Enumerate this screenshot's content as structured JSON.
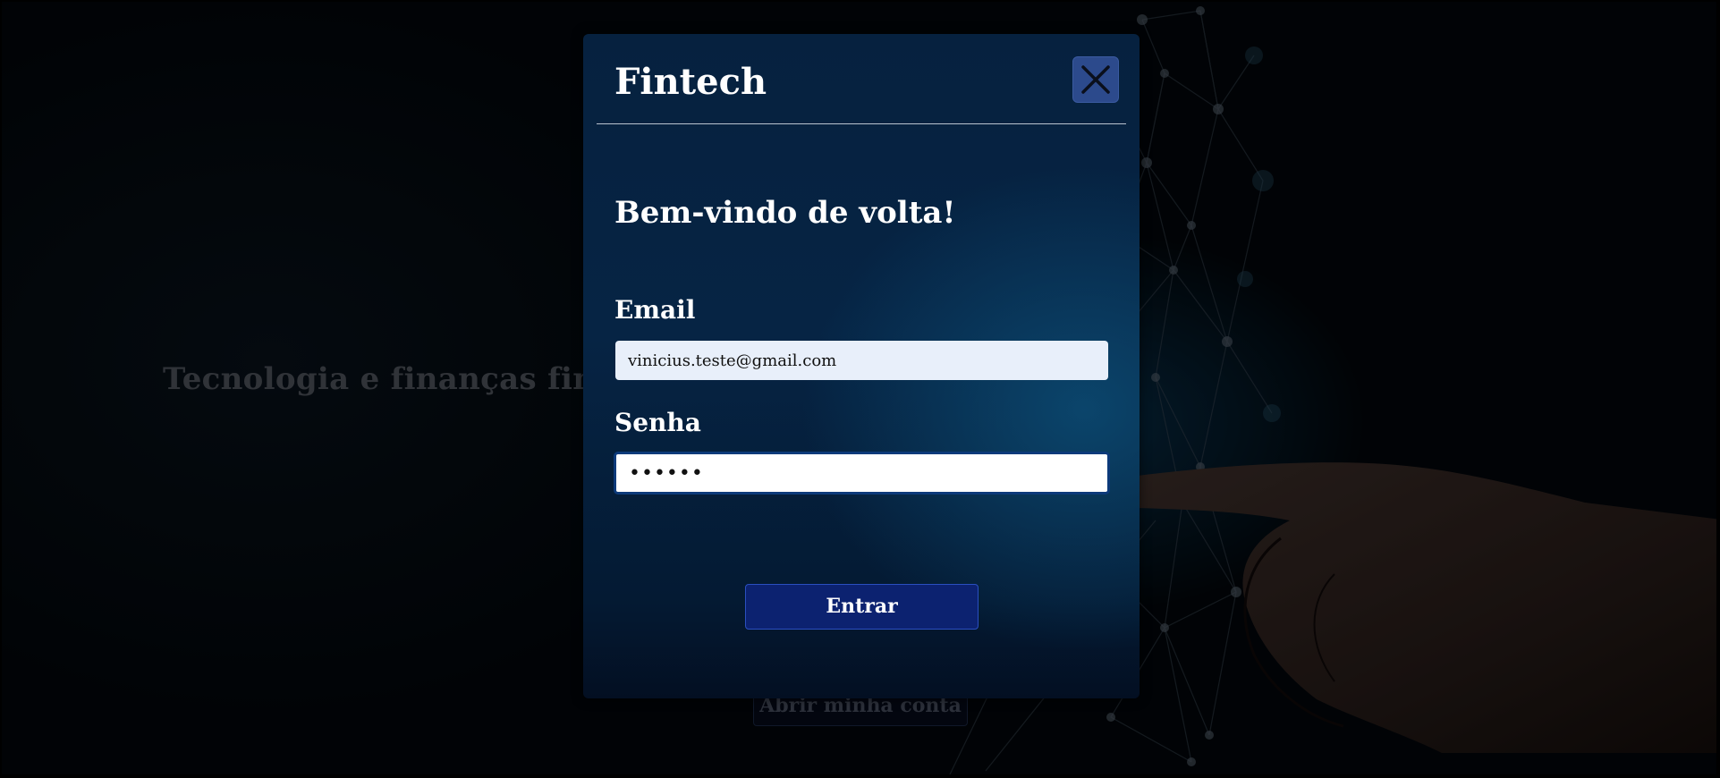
{
  "page": {
    "hero_text": "Tecnologia e finanças finalm",
    "hero_button_label": "Abrir minha conta"
  },
  "modal": {
    "title": "Fintech",
    "close_icon": "close-icon",
    "welcome": "Bem-vindo de volta!",
    "email": {
      "label": "Email",
      "value": "vinicius.teste@gmail.com"
    },
    "senha": {
      "label": "Senha",
      "value": "••••••"
    },
    "submit_label": "Entrar"
  },
  "colors": {
    "modal_bg": "#06213f",
    "close_button": "#2c4a8c",
    "submit_button": "#0c2270",
    "input_focus_border": "#0d3a7a"
  }
}
